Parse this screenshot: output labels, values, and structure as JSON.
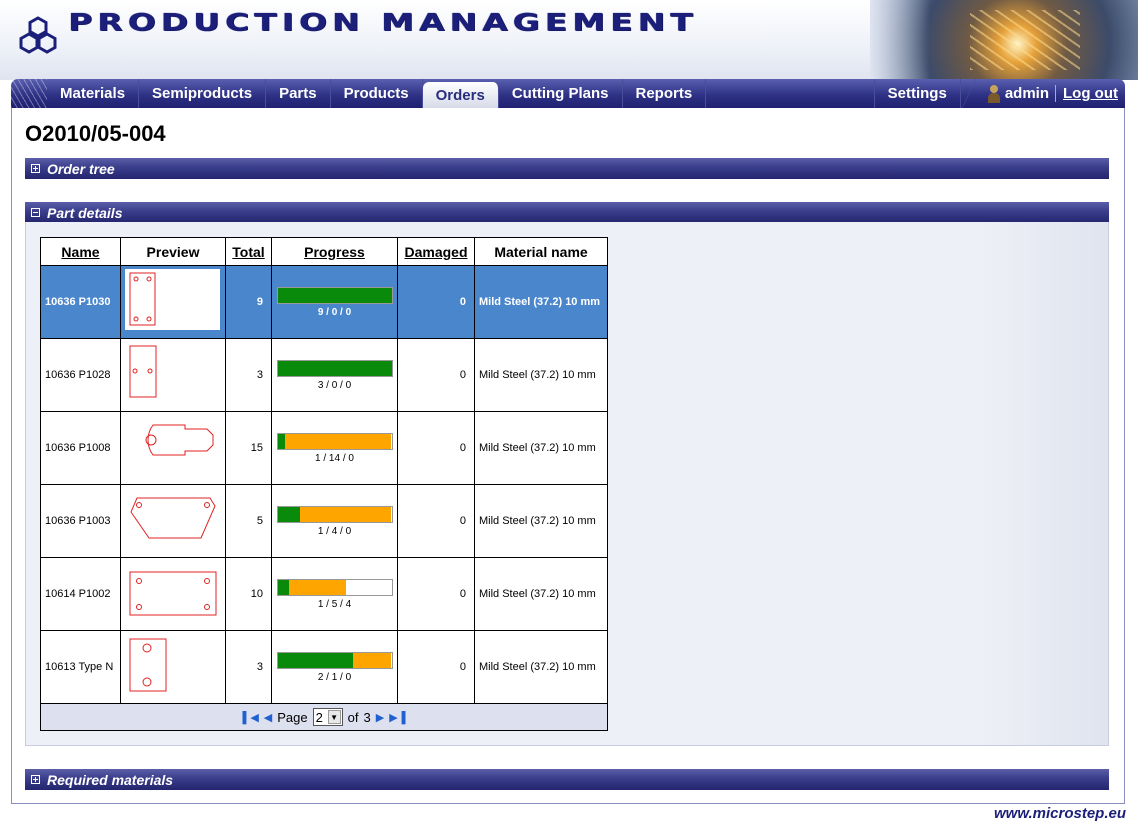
{
  "header": {
    "app_title": "PRODUCTION MANAGEMENT"
  },
  "nav": {
    "items": [
      {
        "label": "Materials"
      },
      {
        "label": "Semiproducts"
      },
      {
        "label": "Parts"
      },
      {
        "label": "Products"
      },
      {
        "label": "Orders",
        "active": true
      },
      {
        "label": "Cutting Plans"
      },
      {
        "label": "Reports"
      }
    ],
    "settings": "Settings",
    "user": "admin",
    "logout": "Log out"
  },
  "page": {
    "title": "O2010/05-004"
  },
  "panels": {
    "order_tree": "Order tree",
    "part_details": "Part details",
    "required_materials": "Required materials"
  },
  "table": {
    "headers": {
      "name": "Name",
      "preview": "Preview",
      "total": "Total",
      "progress": "Progress",
      "damaged": "Damaged",
      "material": "Material name"
    },
    "rows": [
      {
        "name": "10636 P1030",
        "total": "9",
        "progress_label": "9 / 0 / 0",
        "done": 9,
        "in_progress": 0,
        "of": 9,
        "damaged": "0",
        "material": "Mild Steel (37.2) 10 mm",
        "preview": "rect-4holes-tall",
        "selected": true
      },
      {
        "name": "10636 P1028",
        "total": "3",
        "progress_label": "3 / 0 / 0",
        "done": 3,
        "in_progress": 0,
        "of": 3,
        "damaged": "0",
        "material": "Mild Steel (37.2) 10 mm",
        "preview": "rect-2holes-tall"
      },
      {
        "name": "10636 P1008",
        "total": "15",
        "progress_label": "1 / 14 / 0",
        "done": 1,
        "in_progress": 14,
        "of": 15,
        "damaged": "0",
        "material": "Mild Steel (37.2) 10 mm",
        "preview": "key-shape"
      },
      {
        "name": "10636 P1003",
        "total": "5",
        "progress_label": "1 / 4 / 0",
        "done": 1,
        "in_progress": 4,
        "of": 5,
        "damaged": "0",
        "material": "Mild Steel (37.2) 10 mm",
        "preview": "hexagon-2holes"
      },
      {
        "name": "10614 P1002",
        "total": "10",
        "progress_label": "1 / 5 / 4",
        "done": 1,
        "in_progress": 5,
        "of": 10,
        "damaged": "0",
        "material": "Mild Steel (37.2) 10 mm",
        "preview": "rect-4holes-wide"
      },
      {
        "name": "10613 Type N",
        "total": "3",
        "progress_label": "2 / 1 / 0",
        "done": 2,
        "in_progress": 1,
        "of": 3,
        "damaged": "0",
        "material": "Mild Steel (37.2) 10 mm",
        "preview": "rect-2holes-square"
      }
    ]
  },
  "pager": {
    "page_label": "Page",
    "current": "2",
    "of_label": "of",
    "total_pages": "3"
  },
  "footer": {
    "link": "www.microstep.eu"
  },
  "colors": {
    "done": "#0a8a0a",
    "in_progress": "#ffa500",
    "selected_row": "#4a86cc",
    "nav": "#2f3285",
    "preview_stroke": "#e02020"
  }
}
